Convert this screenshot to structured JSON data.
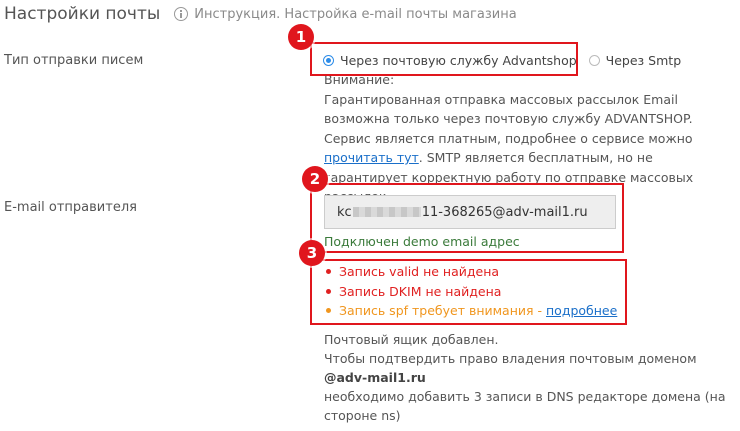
{
  "header": {
    "title": "Настройки почты",
    "help_link": "Инструкция. Настройка e-mail почты магазина"
  },
  "send_type": {
    "label": "Тип отправки писем",
    "options": [
      {
        "label": "Через почтовую службу Advantshop",
        "selected": true
      },
      {
        "label": "Через Smtp",
        "selected": false
      }
    ],
    "notice": {
      "title": "Внимание:",
      "text_before_link": "Гарантированная отправка массовых рассылок Email возможна только через почтовую службу ADVANTSHOP. Сервис является платным, подробнее о сервисе можно ",
      "link": "прочитать тут",
      "text_after_link": ". SMTP является бесплатным, но не гарантирует корректную работу по отправке массовых рассылок."
    }
  },
  "sender_email": {
    "label": "E-mail отправителя",
    "value_prefix": "kc",
    "value_suffix": "11-368265@adv-mail1.ru",
    "demo_note": "Подключен demo email адрес",
    "records": [
      {
        "text": "Запись valid не найдена",
        "status": "error"
      },
      {
        "text": "Запись DKIM не найдена",
        "status": "error"
      },
      {
        "text": "Запись spf требует внимания - ",
        "status": "warning",
        "link": "подробнее"
      }
    ]
  },
  "mailbox": {
    "line1": "Почтовый ящик добавлен.",
    "line2_prefix": "Чтобы подтвердить право владения почтовым доменом ",
    "domain": "@adv-mail1.ru",
    "line3": "необходимо добавить 3 записи в DNS редакторе домена (на стороне ns)"
  },
  "markers": [
    "1",
    "2",
    "3"
  ],
  "colors": {
    "accent": "#2d8ce8",
    "link": "#1a6fc9",
    "error": "#e02020",
    "warning": "#f0961e",
    "success": "#3a7a3a",
    "annotation": "#e0161d"
  },
  "icons": {
    "help": "info-circle-icon"
  }
}
